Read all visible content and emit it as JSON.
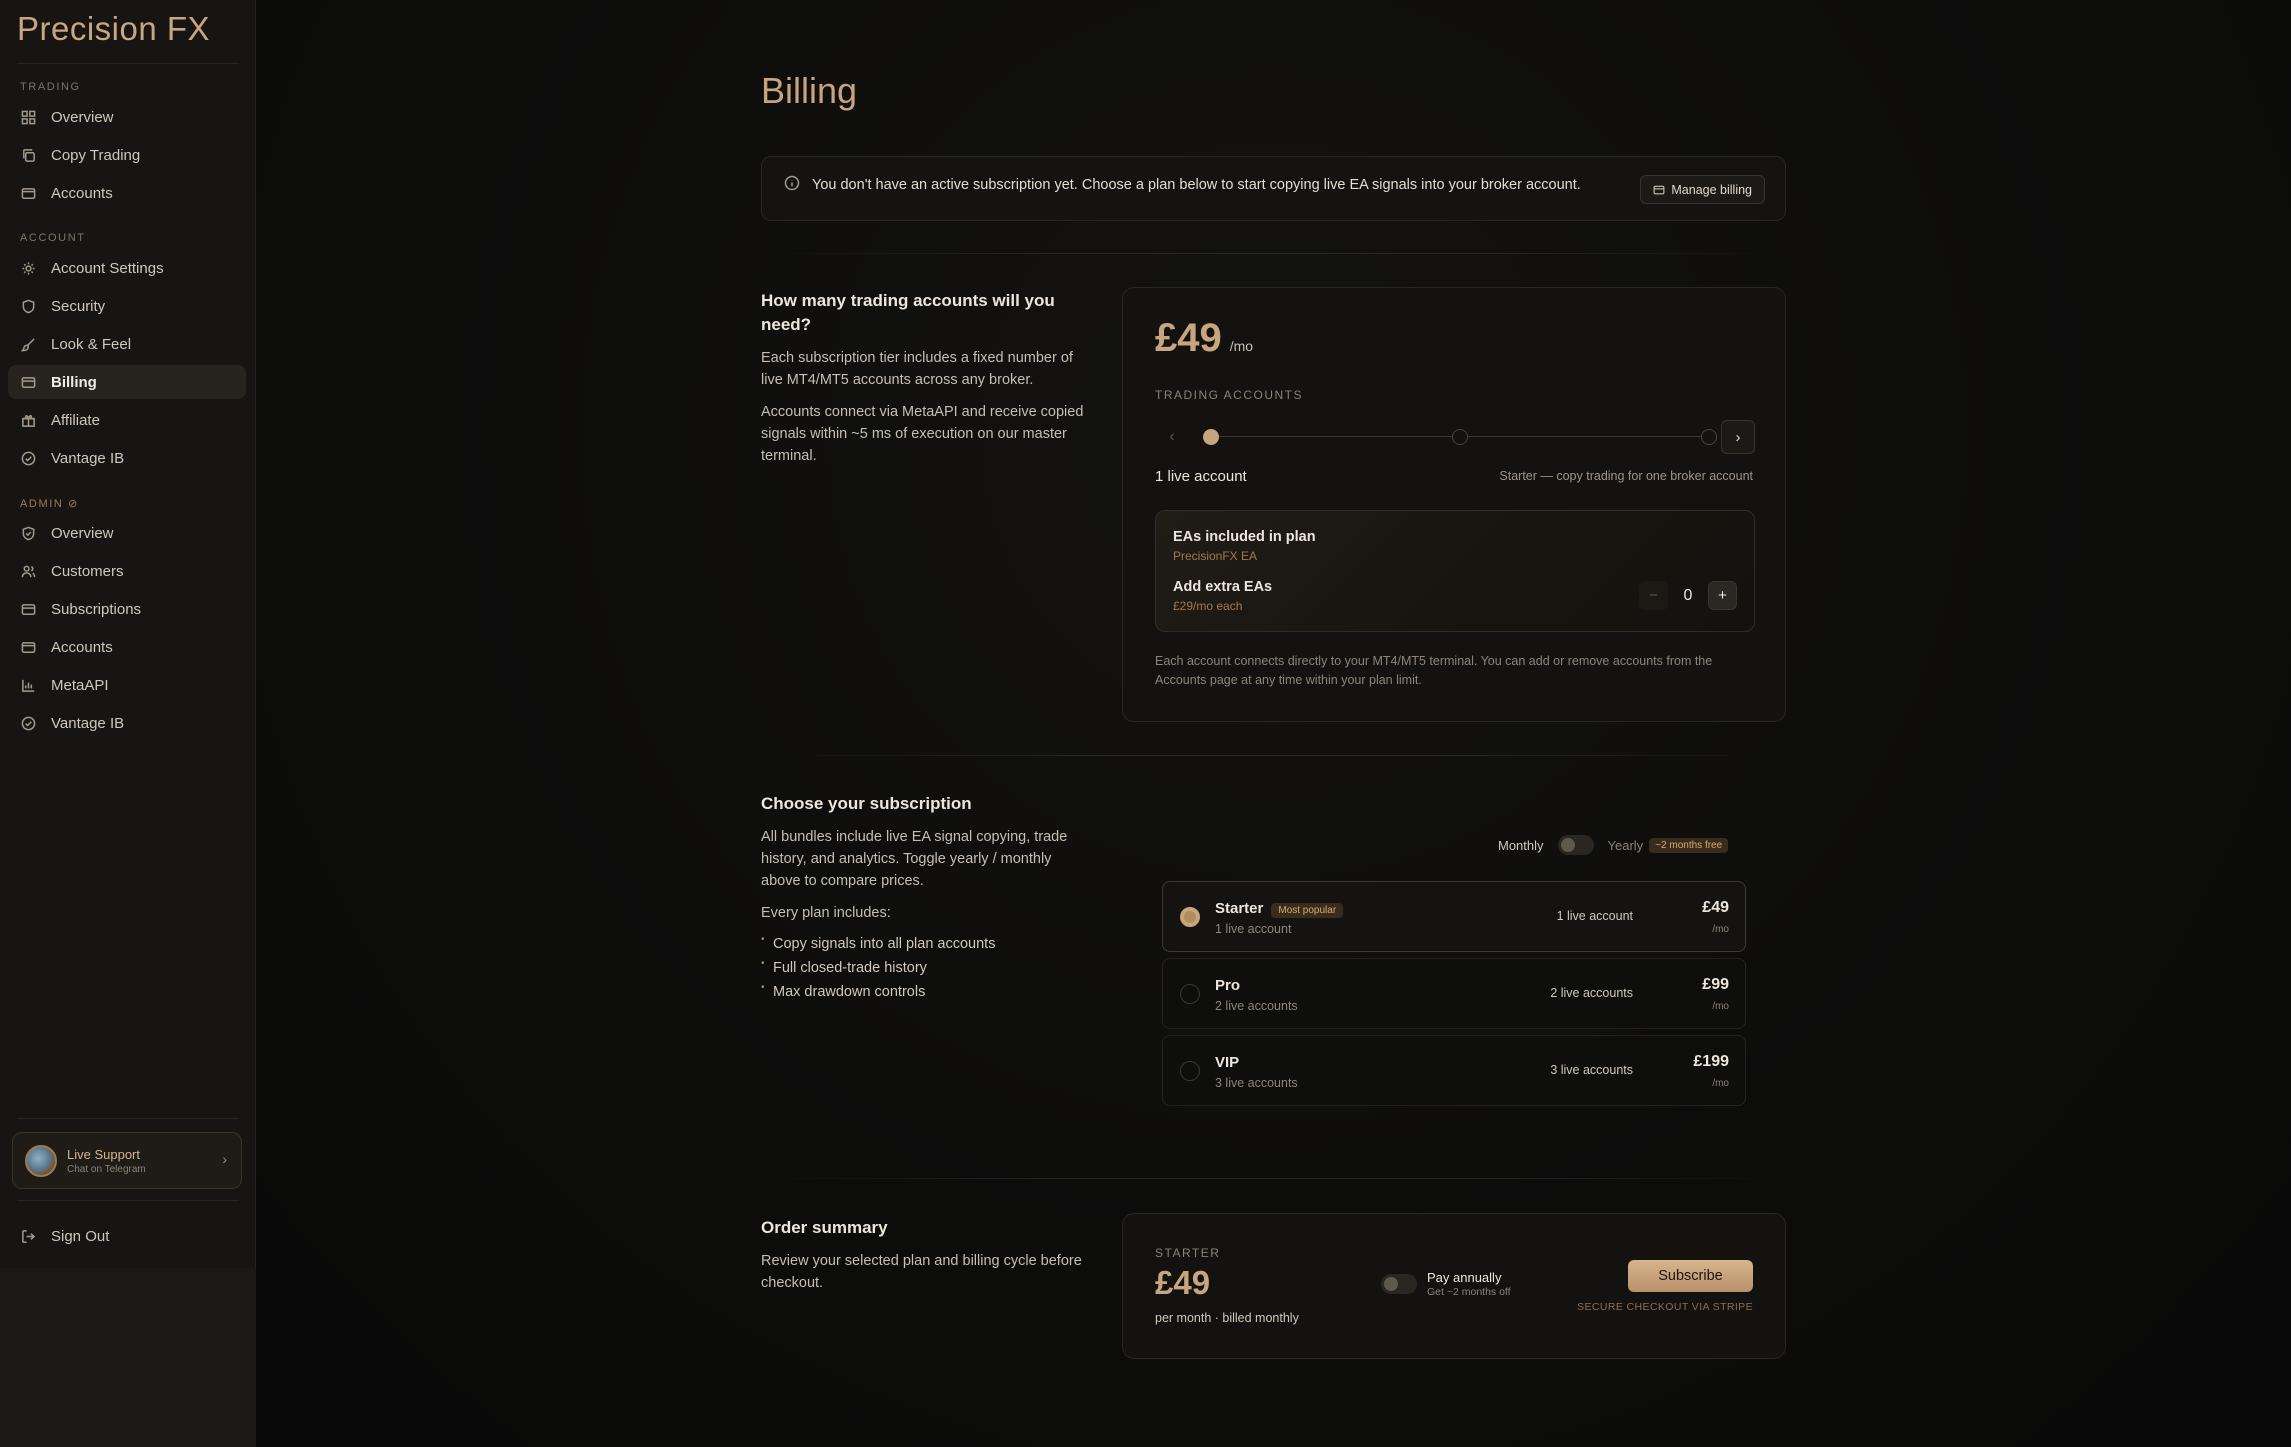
{
  "brand": "Precision FX",
  "sidebar": {
    "sections": {
      "trading": "TRADING",
      "account": "ACCOUNT",
      "admin": "ADMIN ⊘"
    },
    "items": {
      "overview": "Overview",
      "copy_trading": "Copy Trading",
      "accounts": "Accounts",
      "account_settings": "Account Settings",
      "security": "Security",
      "look_feel": "Look & Feel",
      "billing": "Billing",
      "affiliate": "Affiliate",
      "vantage_ib": "Vantage IB",
      "admin_overview": "Overview",
      "customers": "Customers",
      "subscriptions": "Subscriptions",
      "admin_accounts": "Accounts",
      "metaapi": "MetaAPI",
      "admin_vantage_ib": "Vantage IB"
    },
    "support": {
      "title": "Live Support",
      "subtitle": "Chat on Telegram"
    },
    "sign_out": "Sign Out"
  },
  "page": {
    "title": "Billing",
    "banner": {
      "message": "You don't have an active subscription yet. Choose a plan below to start copying live EA signals into your broker account.",
      "manage_label": "Manage billing"
    }
  },
  "accounts_section": {
    "heading": "How many trading accounts will you need?",
    "para1": "Each subscription tier includes a fixed number of live MT4/MT5 accounts across any broker.",
    "para2": "Accounts connect via MetaAPI and receive copied signals within ~5 ms of execution on our master terminal.",
    "price": "£49",
    "price_unit": "/mo",
    "trading_accounts_label": "TRADING ACCOUNTS",
    "selected_accounts": "1 live account",
    "tier_desc": "Starter — copy trading for one broker account",
    "slider": {
      "value": 1,
      "min": 1,
      "max": 3
    },
    "ea_title": "EAs included in plan",
    "ea_name": "PrecisionFX EA",
    "extra_title": "Add extra EAs",
    "extra_price": "£29/mo each",
    "extra_count": "0",
    "note": "Each account connects directly to your MT4/MT5 terminal. You can add or remove accounts from the Accounts page at any time within your plan limit."
  },
  "subscription_section": {
    "heading": "Choose your subscription",
    "para": "All bundles include live EA signal copying, trade history, and analytics. Toggle yearly / monthly above to compare prices.",
    "includes_label": "Every plan includes:",
    "includes": [
      "Copy signals into all plan accounts",
      "Full closed-trade history",
      "Max drawdown controls"
    ],
    "toggle": {
      "monthly": "Monthly",
      "yearly": "Yearly",
      "badge": "~2 months free"
    },
    "plans": [
      {
        "name": "Starter",
        "badge": "Most popular",
        "sub": "1 live account",
        "accounts": "1 live account",
        "price": "£49",
        "per": "/mo"
      },
      {
        "name": "Pro",
        "sub": "2 live accounts",
        "accounts": "2 live accounts",
        "price": "£99",
        "per": "/mo"
      },
      {
        "name": "VIP",
        "sub": "3 live accounts",
        "accounts": "3 live accounts",
        "price": "£199",
        "per": "/mo"
      }
    ]
  },
  "order_summary": {
    "heading": "Order summary",
    "para": "Review your selected plan and billing cycle before checkout.",
    "plan_label": "STARTER",
    "price": "£49",
    "cycle": "per month · billed monthly",
    "annual_title": "Pay annually",
    "annual_sub": "Get ~2 months off",
    "subscribe_label": "Subscribe",
    "secure": "SECURE CHECKOUT VIA STRIPE"
  },
  "colors": {
    "accent": "#c8a57e",
    "background": "#0b0b0b",
    "sidebar": "#161513"
  }
}
